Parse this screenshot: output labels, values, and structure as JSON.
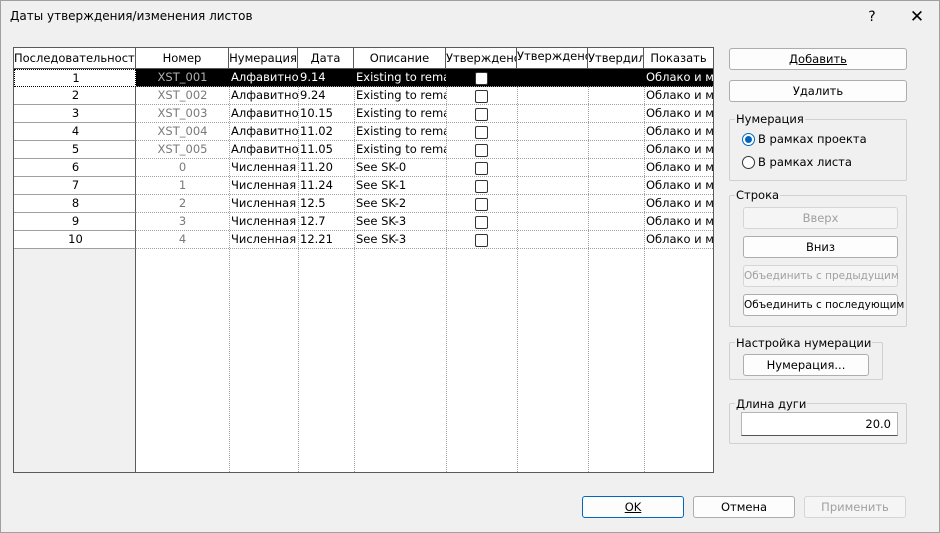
{
  "window": {
    "title": "Даты утверждения/изменения листов",
    "help": "?",
    "close": "✕"
  },
  "grid": {
    "columns": [
      "Последовательность",
      "Номер",
      "Нумерация",
      "Дата",
      "Описание",
      "Утверждено",
      "Утверждено",
      "Утвердил",
      "Показать"
    ],
    "rows": [
      {
        "seq": "1",
        "num": "XST_001",
        "numbering": "Алфавитно",
        "date": "9.14",
        "desc": "Existing to remai",
        "show": "Облако и м"
      },
      {
        "seq": "2",
        "num": "XST_002",
        "numbering": "Алфавитно",
        "date": "9.24",
        "desc": "Existing to remai",
        "show": "Облако и м"
      },
      {
        "seq": "3",
        "num": "XST_003",
        "numbering": "Алфавитно",
        "date": "10.15",
        "desc": "Existing to remai",
        "show": "Облако и м"
      },
      {
        "seq": "4",
        "num": "XST_004",
        "numbering": "Алфавитно",
        "date": "11.02",
        "desc": "Existing to remai",
        "show": "Облако и м"
      },
      {
        "seq": "5",
        "num": "XST_005",
        "numbering": "Алфавитно",
        "date": "11.05",
        "desc": "Existing to remai",
        "show": "Облако и м"
      },
      {
        "seq": "6",
        "num": "0",
        "numbering": "Численная",
        "date": "11.20",
        "desc": "See SK-0",
        "show": "Облако и м"
      },
      {
        "seq": "7",
        "num": "1",
        "numbering": "Численная",
        "date": "11.24",
        "desc": "See SK-1",
        "show": "Облако и м"
      },
      {
        "seq": "8",
        "num": "2",
        "numbering": "Численная",
        "date": "12.5",
        "desc": "See SK-2",
        "show": "Облако и м"
      },
      {
        "seq": "9",
        "num": "3",
        "numbering": "Численная",
        "date": "12.7",
        "desc": "See SK-3",
        "show": "Облако и м"
      },
      {
        "seq": "10",
        "num": "4",
        "numbering": "Численная",
        "date": "12.21",
        "desc": "See SK-3",
        "show": "Облако и м"
      }
    ]
  },
  "panel": {
    "add": "Добавить",
    "delete": "Удалить",
    "numbering_group": "Нумерация",
    "radio_project": "В рамках проекта",
    "radio_sheet": "В рамках листа",
    "row_group": "Строка",
    "up": "Вверх",
    "down": "Вниз",
    "merge_prev": "Объединить с предыдущим",
    "merge_next": "Объединить с последующим",
    "num_settings_group": "Настройка нумерации",
    "numbering_btn": "Нумерация...",
    "arc_group": "Длина дуги",
    "arc_value": "20.0"
  },
  "footer": {
    "ok": "OK",
    "cancel": "Отмена",
    "apply": "Применить"
  },
  "colors": {
    "accent": "#0067c0",
    "selected_row": "#000000"
  }
}
